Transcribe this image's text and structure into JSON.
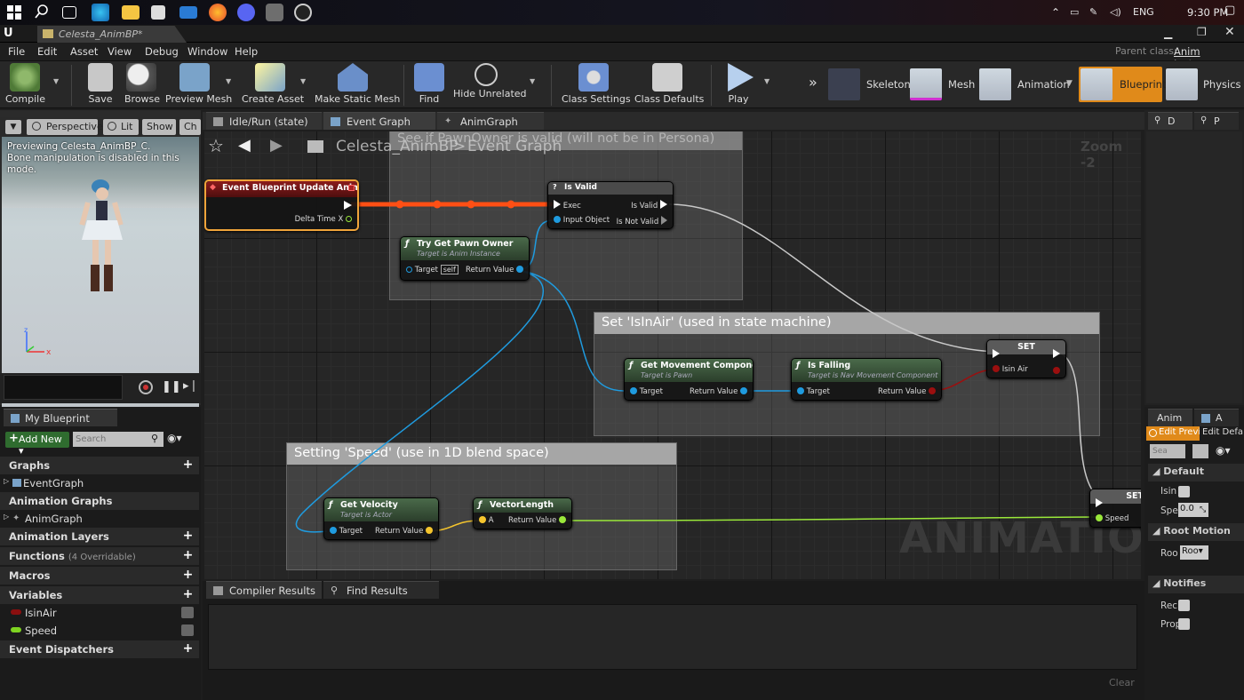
{
  "taskbar": {
    "time": "9:30 PM",
    "lang": "ENG"
  },
  "window": {
    "doc_tab": "Celesta_AnimBP*",
    "parent_class_label": "Parent class:",
    "parent_class": "Anim Instance"
  },
  "menu": [
    "File",
    "Edit",
    "Asset",
    "View",
    "Debug",
    "Window",
    "Help"
  ],
  "toolbar": {
    "buttons": [
      "Compile",
      "Save",
      "Browse",
      "Preview Mesh",
      "Create Asset",
      "Make Static Mesh",
      "Find",
      "Hide Unrelated",
      "Class Settings",
      "Class Defaults",
      "Play"
    ],
    "modes": [
      "Skeleton",
      "Mesh",
      "Animation",
      "Blueprint",
      "Physics"
    ]
  },
  "viewport": {
    "buttons": [
      "Perspective",
      "Lit",
      "Show",
      "Ch"
    ],
    "info_line1": "Previewing Celesta_AnimBP_C.",
    "info_line2": "Bone manipulation is disabled in this mode."
  },
  "my_blueprint": {
    "tab": "My Blueprint",
    "add_new": "Add New",
    "search_placeholder": "Search",
    "graphs": "Graphs",
    "event_graph": "EventGraph",
    "anim_graphs": "Animation Graphs",
    "anim_graph": "AnimGraph",
    "anim_layers": "Animation Layers",
    "functions": "Functions",
    "functions_count": "(4 Overridable)",
    "macros": "Macros",
    "variables": "Variables",
    "var1": "IsinAir",
    "var2": "Speed",
    "dispatchers": "Event Dispatchers"
  },
  "graph_tabs": [
    "Idle/Run (state)",
    "Event Graph",
    "AnimGraph"
  ],
  "graph": {
    "breadcrumb_bp": "Celesta_AnimBP",
    "breadcrumb_sep": ">",
    "breadcrumb_graph": "Event Graph",
    "zoom": "Zoom -2",
    "watermark": "ANIMATION",
    "comments": {
      "c1": "See if PawnOwner is valid (will not be in Persona)",
      "c2": "Set 'IsInAir' (used in state machine)",
      "c3": "Setting 'Speed' (use in 1D blend space)"
    },
    "nodes": {
      "event": {
        "title": "Event Blueprint Update Animation",
        "pin": "Delta Time X"
      },
      "isvalid": {
        "title": "Is Valid",
        "exec": "Exec",
        "input": "Input Object",
        "out1": "Is Valid",
        "out2": "Is Not Valid"
      },
      "trypawn": {
        "title": "Try Get Pawn Owner",
        "sub": "Target is Anim Instance",
        "target": "Target",
        "self": "self",
        "ret": "Return Value"
      },
      "getmove": {
        "title": "Get Movement Component",
        "sub": "Target is Pawn",
        "target": "Target",
        "ret": "Return Value"
      },
      "isfalling": {
        "title": "Is Falling",
        "sub": "Target is Nav Movement Component",
        "target": "Target",
        "ret": "Return Value"
      },
      "set1": {
        "title": "SET",
        "pin": "Isin Air"
      },
      "set2": {
        "title": "SET",
        "pin": "Speed"
      },
      "getvel": {
        "title": "Get Velocity",
        "sub": "Target is Actor",
        "target": "Target",
        "ret": "Return Value"
      },
      "veclen": {
        "title": "VectorLength",
        "a": "A",
        "ret": "Return Value"
      }
    }
  },
  "bottom": {
    "tab1": "Compiler Results",
    "tab2": "Find Results",
    "clear": "Clear"
  },
  "right_top": {
    "tab1": "D",
    "tab2": "P"
  },
  "details": {
    "tab1": "Anim",
    "tab2": "A",
    "edit_preview": "Edit Preview",
    "edit_defaults": "Edit Defa",
    "search": "Sea",
    "default": "Default",
    "isin": "Isin",
    "spe": "Spe",
    "speed_value": "0.0",
    "root_motion": "Root Motion",
    "roo": "Roo",
    "roo_value": "Roo",
    "notifies": "Notifies",
    "rec": "Rec",
    "prop": "Prop"
  },
  "colors": {
    "exec": "#ff5a1f",
    "bool": "#9b0f0f",
    "object": "#1f9bdf",
    "float": "#9ae83a",
    "vector": "#f5c52d"
  }
}
